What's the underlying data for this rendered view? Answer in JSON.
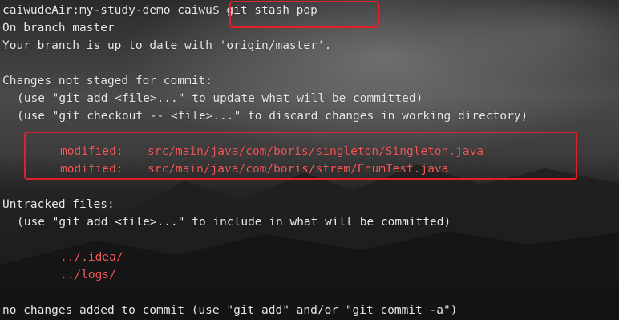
{
  "terminal": {
    "prompt": "caiwudeAir:my-study-demo caiwu$",
    "command": "git stash pop",
    "branch_line": "On branch master",
    "uptodate_line": "Your branch is up to date with 'origin/master'.",
    "changes_header": "Changes not staged for commit:",
    "hint_add_update": "(use \"git add <file>...\" to update what will be committed)",
    "hint_checkout": "(use \"git checkout -- <file>...\" to discard changes in working directory)",
    "modified": [
      {
        "status": "modified:",
        "path": "src/main/java/com/boris/singleton/Singleton.java"
      },
      {
        "status": "modified:",
        "path": "src/main/java/com/boris/strem/EnumTest.java"
      }
    ],
    "untracked_header": "Untracked files:",
    "hint_add_include": "(use \"git add <file>...\" to include in what will be committed)",
    "untracked": [
      "../.idea/",
      "../logs/"
    ],
    "footer": "no changes added to commit (use \"git add\" and/or \"git commit -a\")"
  },
  "colors": {
    "text": "#e9e9e9",
    "git_red": "#f25a5a",
    "highlight_box": "#e2202a"
  }
}
